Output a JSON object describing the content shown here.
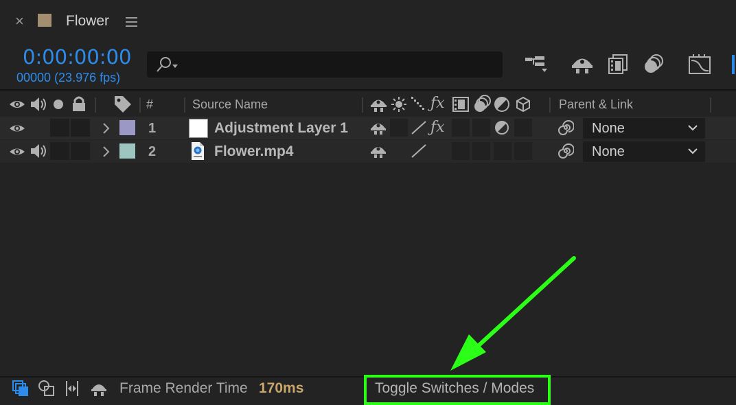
{
  "tab": {
    "close": "×",
    "title": "Flower",
    "swatch_color": "#a38f6f",
    "menu_icon": "hamburger-menu-icon"
  },
  "header": {
    "timecode": "0:00:00:00",
    "frames": "00000 (23.976 fps)",
    "search_icon": "search-icon",
    "tools": [
      "composition-mini-flowchart-icon",
      "draft-3d-icon",
      "frame-blending-icon",
      "motion-blur-icon",
      "graph-editor-icon"
    ]
  },
  "columns": {
    "number": "#",
    "source_name": "Source Name",
    "parent_link": "Parent & Link"
  },
  "layers": [
    {
      "num": "1",
      "name": "Adjustment Layer 1",
      "label_color": "#9b98c5",
      "parent": "None"
    },
    {
      "num": "2",
      "name": "Flower.mp4",
      "label_color": "#9dc6c0",
      "parent": "None"
    }
  ],
  "bottom": {
    "render_label": "Frame Render Time",
    "render_value": "170ms",
    "toggle": "Toggle Switches / Modes",
    "highlight_color": "#2bff17"
  },
  "accent": "#2d8ceb"
}
